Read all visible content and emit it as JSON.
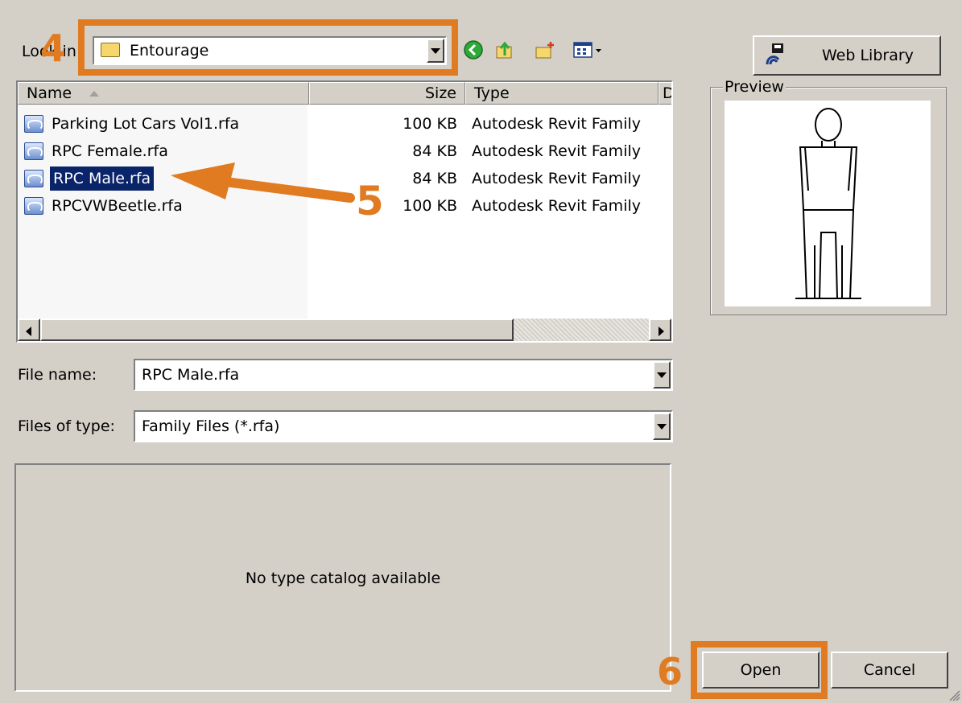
{
  "lookin": {
    "label": "Look in:",
    "value": "Entourage"
  },
  "toolbar": {
    "icons": [
      "back-icon",
      "up-folder-icon",
      "new-folder-icon",
      "view-menu-icon"
    ]
  },
  "web_library": {
    "label": "Web Library"
  },
  "file_list": {
    "columns": [
      "Name",
      "Size",
      "Type",
      "D"
    ],
    "rows": [
      {
        "name": "Parking Lot Cars Vol1.rfa",
        "size": "100 KB",
        "type": "Autodesk Revit Family"
      },
      {
        "name": "RPC Female.rfa",
        "size": "84 KB",
        "type": "Autodesk Revit Family"
      },
      {
        "name": "RPC Male.rfa",
        "size": "84 KB",
        "type": "Autodesk Revit Family"
      },
      {
        "name": "RPCVWBeetle.rfa",
        "size": "100 KB",
        "type": "Autodesk Revit Family"
      }
    ],
    "selected_row": 2
  },
  "preview": {
    "label": "Preview"
  },
  "file_name": {
    "label": "File name:",
    "value": "RPC Male.rfa"
  },
  "file_type": {
    "label": "Files of type:",
    "value": "Family Files (*.rfa)"
  },
  "type_catalog": {
    "message": "No type catalog available"
  },
  "buttons": {
    "open": "Open",
    "cancel": "Cancel"
  },
  "annotations": {
    "step4": "4",
    "step5": "5",
    "step6": "6"
  },
  "colors": {
    "annotation": "#e07b21",
    "selection": "#0a246a",
    "dialog": "#d4d0c8"
  }
}
